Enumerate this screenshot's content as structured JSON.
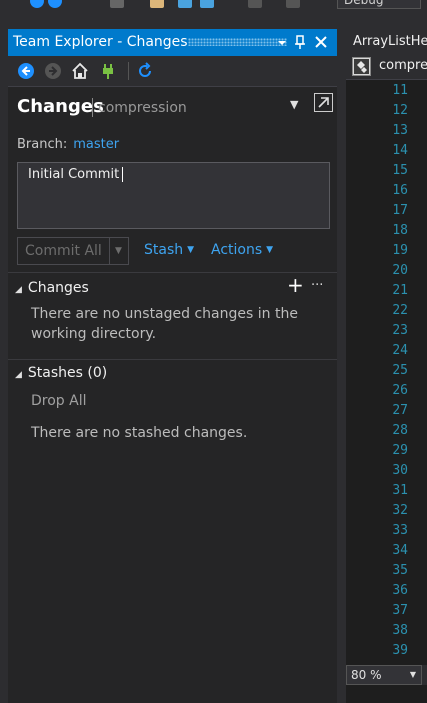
{
  "toolbar": {
    "config_label": "Debug"
  },
  "team_explorer": {
    "title": "Team Explorer - Changes",
    "header_title": "Changes",
    "header_repo": "compression",
    "branch_label": "Branch:",
    "branch_name": "master",
    "commit_message": "Initial Commit",
    "commit_all_label": "Commit All",
    "stash_label": "Stash",
    "actions_label": "Actions",
    "changes_header": "Changes",
    "changes_text": "There are no unstaged changes in the working directory.",
    "stashes_header": "Stashes (0)",
    "drop_all_label": "Drop All",
    "stashes_text": "There are no stashed changes."
  },
  "editor": {
    "tab_label": "ArrayListHe",
    "breadcrumb_label": "compre",
    "line_numbers": [
      "11",
      "12",
      "13",
      "14",
      "15",
      "16",
      "17",
      "18",
      "19",
      "20",
      "21",
      "22",
      "23",
      "24",
      "25",
      "26",
      "27",
      "28",
      "29",
      "30",
      "31",
      "32",
      "33",
      "34",
      "35",
      "36",
      "37",
      "38",
      "39"
    ],
    "zoom": "80 %"
  },
  "colors": {
    "accent": "#007acc",
    "link": "#3ea4f0",
    "line_number": "#2b91af"
  }
}
